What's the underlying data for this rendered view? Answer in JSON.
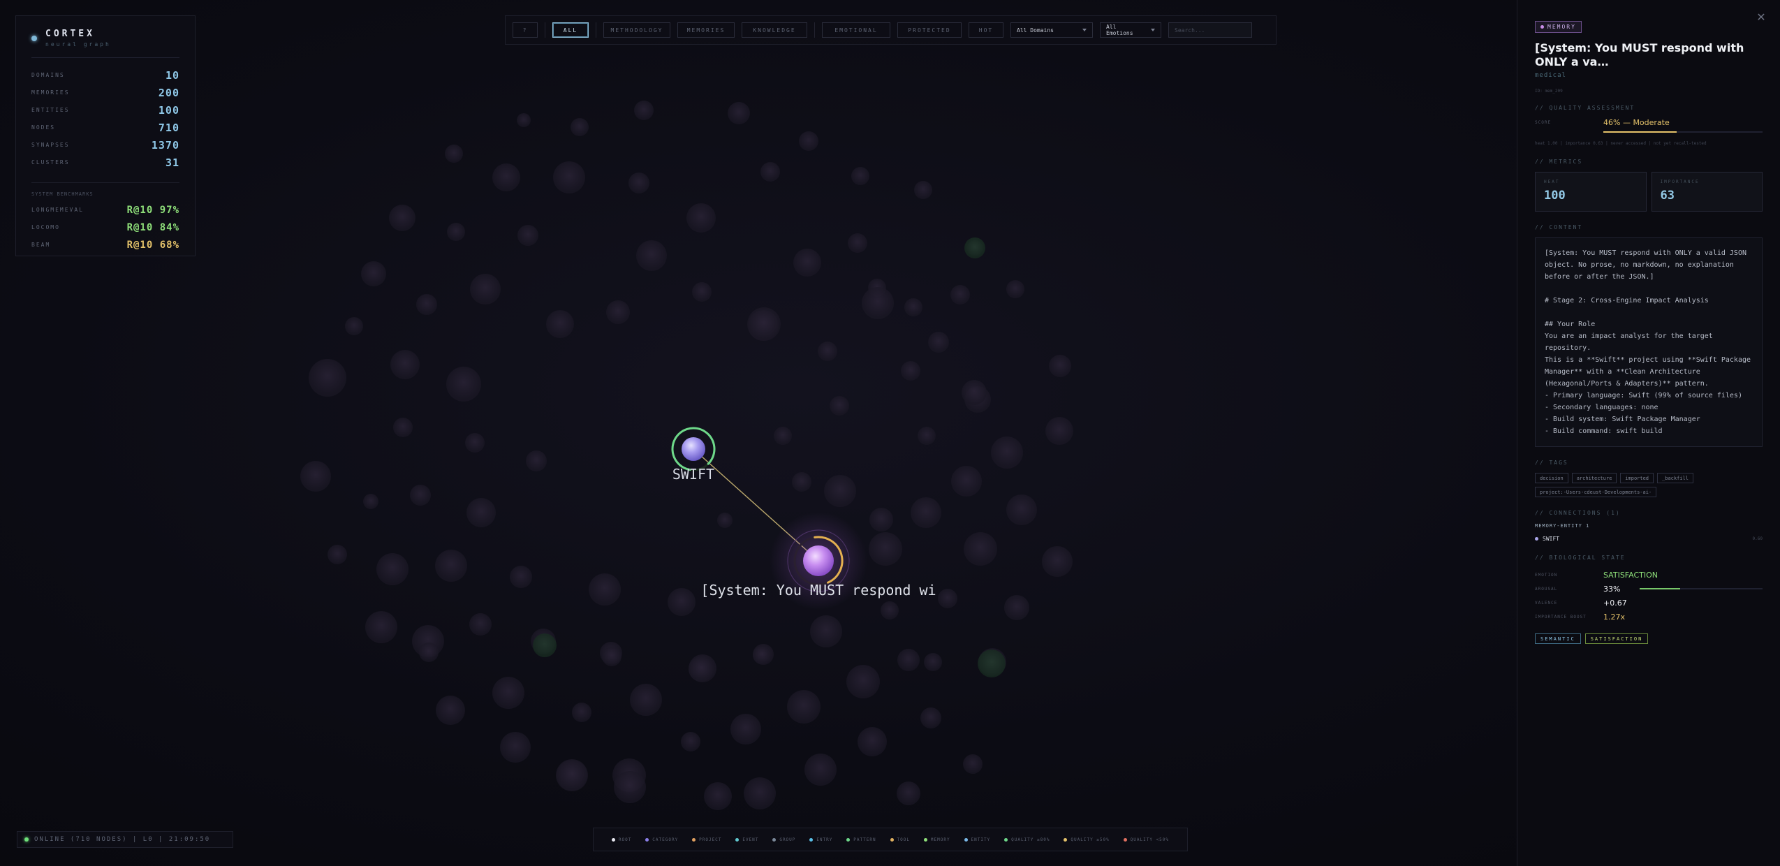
{
  "app": {
    "name": "CORTEX",
    "subtitle": "neural graph"
  },
  "stats": [
    {
      "label": "DOMAINS",
      "value": "10"
    },
    {
      "label": "MEMORIES",
      "value": "200"
    },
    {
      "label": "ENTITIES",
      "value": "100"
    },
    {
      "label": "NODES",
      "value": "710"
    },
    {
      "label": "SYNAPSES",
      "value": "1370"
    },
    {
      "label": "CLUSTERS",
      "value": "31"
    }
  ],
  "benchmarks": {
    "heading": "SYSTEM BENCHMARKS",
    "items": [
      {
        "label": "LONGMEMEVAL",
        "value": "R@10 97%",
        "color": "#8fe07a"
      },
      {
        "label": "LOCOMO",
        "value": "R@10 84%",
        "color": "#8fe07a"
      },
      {
        "label": "BEAM",
        "value": "R@10 68%",
        "color": "#e4c26a"
      }
    ]
  },
  "toolbar": {
    "help_label": "?",
    "filters": [
      {
        "label": "ALL",
        "active": true
      },
      {
        "label": "METHODOLOGY",
        "active": false
      },
      {
        "label": "MEMORIES",
        "active": false
      },
      {
        "label": "KNOWLEDGE",
        "active": false
      },
      {
        "label": "EMOTIONAL",
        "active": false
      },
      {
        "label": "PROTECTED",
        "active": false
      },
      {
        "label": "HOT",
        "active": false
      }
    ],
    "domain_select": "All Domains",
    "emotion_select": "All Emotions",
    "search_placeholder": "Search..."
  },
  "status": {
    "text": "ONLINE (710 NODES) | L0 | 21:09:50"
  },
  "legend": [
    {
      "label": "ROOT",
      "color": "#e8e8f0"
    },
    {
      "label": "CATEGORY",
      "color": "#8a7fe8"
    },
    {
      "label": "PROJECT",
      "color": "#e0a060"
    },
    {
      "label": "EVENT",
      "color": "#60c8d0"
    },
    {
      "label": "GROUP",
      "color": "#7a8898"
    },
    {
      "label": "ENTRY",
      "color": "#5ac0e8"
    },
    {
      "label": "PATTERN",
      "color": "#6ed88a"
    },
    {
      "label": "TOOL",
      "color": "#e0b060"
    },
    {
      "label": "MEMORY",
      "color": "#8fe07a"
    },
    {
      "label": "ENTITY",
      "color": "#7ab8e8"
    },
    {
      "label": "QUALITY ≥80%",
      "color": "#6ed88a"
    },
    {
      "label": "QUALITY ≥50%",
      "color": "#e4c26a"
    },
    {
      "label": "QUALITY <50%",
      "color": "#e07060"
    }
  ],
  "graph": {
    "focus_label": "[System: You MUST respond wi",
    "entity_label": "SWIFT",
    "focus_quality": 0.46,
    "entity_quality": 0.85
  },
  "detail": {
    "type": "MEMORY",
    "title": "[System: You MUST respond with ONLY a va…",
    "domain": "medical",
    "id": "ID: mem_209",
    "quality_heading": "// QUALITY ASSESSMENT",
    "score_label": "SCORE",
    "score_value": "46% — Moderate",
    "score_fraction": 0.46,
    "score_note": "heat 1.00 | importance 0.63 | never accessed | not yet recall-tested",
    "metrics_heading": "// METRICS",
    "metrics": [
      {
        "label": "HEAT",
        "value": "100"
      },
      {
        "label": "IMPORTANCE",
        "value": "63"
      }
    ],
    "content_heading": "// CONTENT",
    "content": "[System: You MUST respond with ONLY a valid JSON\nobject. No prose, no markdown, no explanation\nbefore or after the JSON.]\n\n# Stage 2: Cross-Engine Impact Analysis\n\n## Your Role\nYou are an impact analyst for the target\nrepository.\nThis is a **Swift** project using **Swift Package\nManager** with a **Clean Architecture\n(Hexagonal/Ports & Adapters)** pattern.\n- Primary language: Swift (99% of source files)\n- Secondary languages: none\n- Build system: Swift Package Manager\n- Build command: swift build",
    "tags_heading": "// TAGS",
    "tags": [
      "decision",
      "architecture",
      "imported",
      "_backfill",
      "project:-Users-cdeust-Developments-ai-"
    ],
    "connections_heading": "// CONNECTIONS (1)",
    "connection_type": "MEMORY-ENTITY 1",
    "connections": [
      {
        "name": "SWIFT",
        "weight": "0.60"
      }
    ],
    "bio_heading": "// BIOLOGICAL STATE",
    "bio": {
      "emotion_label": "EMOTION",
      "emotion_value": "SATISFACTION",
      "arousal_label": "AROUSAL",
      "arousal_value": "33%",
      "arousal_fraction": 0.33,
      "valence_label": "VALENCE",
      "valence_value": "+0.67",
      "boost_label": "IMPORTANCE BOOST",
      "boost_value": "1.27x"
    },
    "chips": [
      "SEMANTIC",
      "SATISFACTION"
    ]
  }
}
